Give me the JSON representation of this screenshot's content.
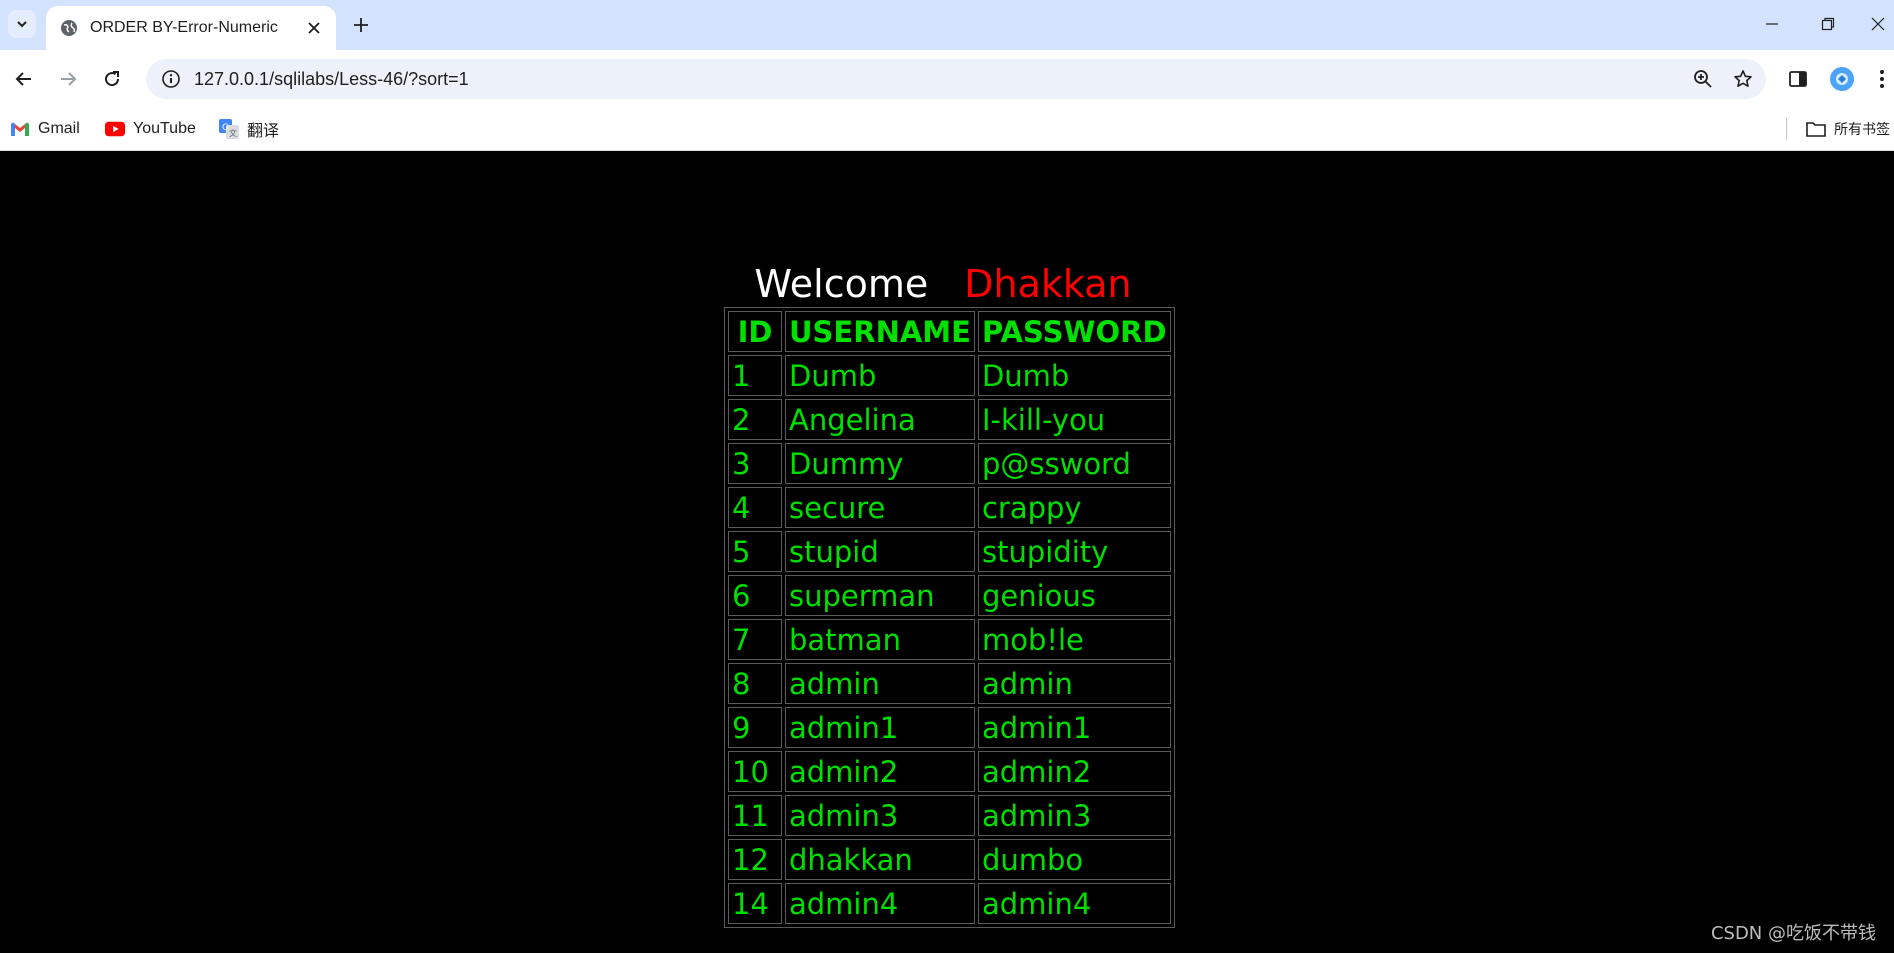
{
  "browser": {
    "tab_title": "ORDER BY-Error-Numeric",
    "url": "127.0.0.1/sqlilabs/Less-46/?sort=1",
    "bookmarks": [
      {
        "label": "Gmail",
        "icon": "gmail-icon"
      },
      {
        "label": "YouTube",
        "icon": "youtube-icon"
      },
      {
        "label": "翻译",
        "icon": "google-translate-icon"
      }
    ],
    "all_bookmarks_label": "所有书签"
  },
  "page": {
    "welcome": "Welcome",
    "name": "Dhakkan",
    "colors": {
      "text": "#00e000",
      "name": "#ff0000",
      "background": "#000000"
    },
    "table": {
      "headers": [
        "ID",
        "USERNAME",
        "PASSWORD"
      ],
      "rows": [
        [
          "1",
          "Dumb",
          "Dumb"
        ],
        [
          "2",
          "Angelina",
          "I-kill-you"
        ],
        [
          "3",
          "Dummy",
          "p@ssword"
        ],
        [
          "4",
          "secure",
          "crappy"
        ],
        [
          "5",
          "stupid",
          "stupidity"
        ],
        [
          "6",
          "superman",
          "genious"
        ],
        [
          "7",
          "batman",
          "mob!le"
        ],
        [
          "8",
          "admin",
          "admin"
        ],
        [
          "9",
          "admin1",
          "admin1"
        ],
        [
          "10",
          "admin2",
          "admin2"
        ],
        [
          "11",
          "admin3",
          "admin3"
        ],
        [
          "12",
          "dhakkan",
          "dumbo"
        ],
        [
          "14",
          "admin4",
          "admin4"
        ]
      ]
    }
  },
  "watermark": "CSDN @吃饭不带钱"
}
